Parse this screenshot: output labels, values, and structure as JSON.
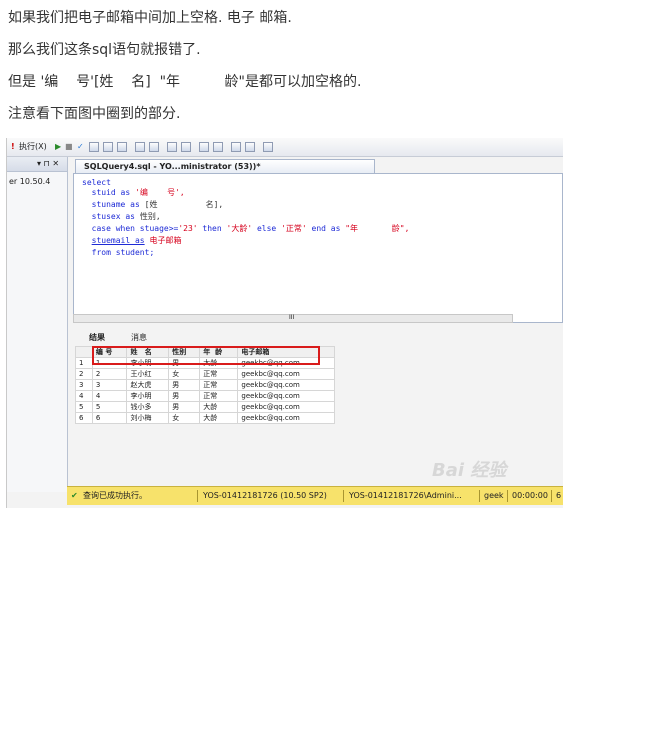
{
  "article": {
    "line1": "如果我们把电子邮箱中间加上空格. 电子 邮箱.",
    "line2": "那么我们这条sql语句就报错了.",
    "line3": "但是 '编    号'[姓    名]  \"年          龄\"是都可以加空格的.",
    "line4": "注意看下面图中圈到的部分."
  },
  "screenshot": {
    "toolbar": {
      "execute_label": "执行(X)"
    },
    "left_panel": {
      "pin": "▾ ⊓ ✕",
      "server": "er 10.50.4"
    },
    "editor_tab": "SQLQuery4.sql - YO...ministrator (53))*",
    "code": {
      "l1": "select",
      "l2_kw": "stuid as",
      "l2_str": "'编    号',",
      "l3_kw": "stuname as",
      "l3_pl": "[姓          名],",
      "l4_kw": "stusex as",
      "l4_pl": "性别,",
      "l5_a": "case when stuage>=",
      "l5_b": "'23'",
      "l5_c": " then ",
      "l5_d": "'大龄'",
      "l5_e": " else ",
      "l5_f": "'正常'",
      "l5_g": " end as ",
      "l5_h": "\"年       龄\",",
      "l6_kw": "stuemail as",
      "l6_pl": "电子邮箱",
      "l7": "from student;"
    },
    "hscroll_mark": "III",
    "result_tabs": {
      "results": "结果",
      "messages": "消息"
    },
    "grid": {
      "headers": [
        "",
        "编 号",
        "姓   名",
        "性别",
        "年  龄",
        "电子邮箱"
      ],
      "rows": [
        [
          "1",
          "1",
          "李小明",
          "男",
          "大龄",
          "geekbc@qq.com"
        ],
        [
          "2",
          "2",
          "王小红",
          "女",
          "正常",
          "geekbc@qq.com"
        ],
        [
          "3",
          "3",
          "赵大虎",
          "男",
          "正常",
          "geekbc@qq.com"
        ],
        [
          "4",
          "4",
          "李小明",
          "男",
          "正常",
          "geekbc@qq.com"
        ],
        [
          "5",
          "5",
          "钱小多",
          "男",
          "大龄",
          "geekbc@qq.com"
        ],
        [
          "6",
          "6",
          "刘小梅",
          "女",
          "大龄",
          "geekbc@qq.com"
        ]
      ]
    },
    "watermark": "Bai 经验",
    "status": {
      "message": "查询已成功执行。",
      "server": "YOS-01412181726 (10.50 SP2)",
      "user": "YOS-01412181726\\Admini...",
      "db": "geek",
      "time": "00:00:00",
      "rows": "6"
    },
    "colors": {
      "highlight_box": "#d91b1b",
      "status_bar": "#f7e26b",
      "keyword": "#1e2bd6",
      "string": "#d6001c"
    }
  }
}
